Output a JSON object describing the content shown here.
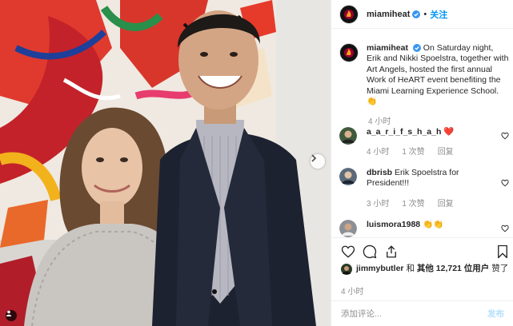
{
  "post": {
    "username": "miamiheat",
    "follow_label": "关注",
    "dot": "•",
    "caption_username": "miamiheat",
    "caption": "On Saturday night, Erik and Nikki Spoelstra, together with Art Angels, hosted the first annual Work of HeART event benefiting the Miami Learning Experience School. 👏",
    "caption_time": "4 小时"
  },
  "comments": [
    {
      "username": "a_a_r_i_f_s_h_a_h",
      "text": "❤️",
      "time": "4 小时",
      "likes": "1 次赞",
      "reply": "回复"
    },
    {
      "username": "dbrisb",
      "text": "Erik Spoelstra for President!!!",
      "time": "3 小时",
      "likes": "1 次赞",
      "reply": "回复"
    },
    {
      "username": "luismora1988",
      "text": "👏👏"
    }
  ],
  "likes": {
    "first_user": "jimmybutler",
    "connector": "和",
    "others": "其他 12,721 位用户",
    "suffix": "赞了"
  },
  "post_time": "4 小时",
  "comment_box": {
    "placeholder": "添加评论...",
    "post_label": "发布"
  },
  "icons": [
    "heart-icon",
    "comment-icon",
    "share-icon",
    "bookmark-icon",
    "verified-icon",
    "tag-person-icon",
    "chevron-right-icon"
  ],
  "colors": {
    "accent": "#0095f6",
    "muted": "#8e8e8e",
    "post_disabled": "#b2dffc",
    "heat_red": "#98002e"
  }
}
